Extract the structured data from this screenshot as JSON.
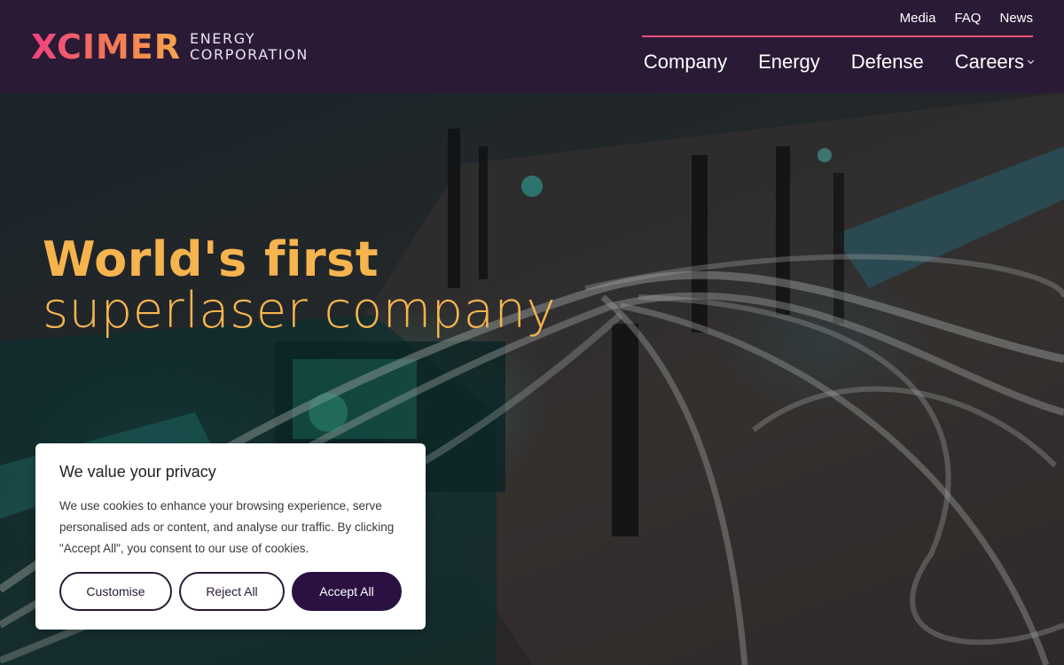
{
  "header": {
    "logo": {
      "word": "XCIMER",
      "line1": "ENERGY",
      "line2": "CORPORATION"
    },
    "top_links": [
      "Media",
      "FAQ",
      "News"
    ],
    "nav": [
      "Company",
      "Energy",
      "Defense",
      "Careers"
    ],
    "colors": {
      "background": "#2a1a36",
      "accent": "#ef4f78",
      "logo_gradient_start": "#f0427f",
      "logo_gradient_end": "#f7a64b"
    }
  },
  "hero": {
    "line1": "World's first",
    "line2": "superlaser company",
    "color": "#f6b44e"
  },
  "cookie": {
    "title": "We value your privacy",
    "text": "We use cookies to enhance your browsing experience, serve personalised ads or content, and analyse our traffic. By clicking \"Accept All\", you consent to our use of cookies.",
    "buttons": {
      "customise": "Customise",
      "reject": "Reject All",
      "accept": "Accept All"
    }
  },
  "icons": {
    "careers_dropdown": "chevron-down-icon"
  }
}
